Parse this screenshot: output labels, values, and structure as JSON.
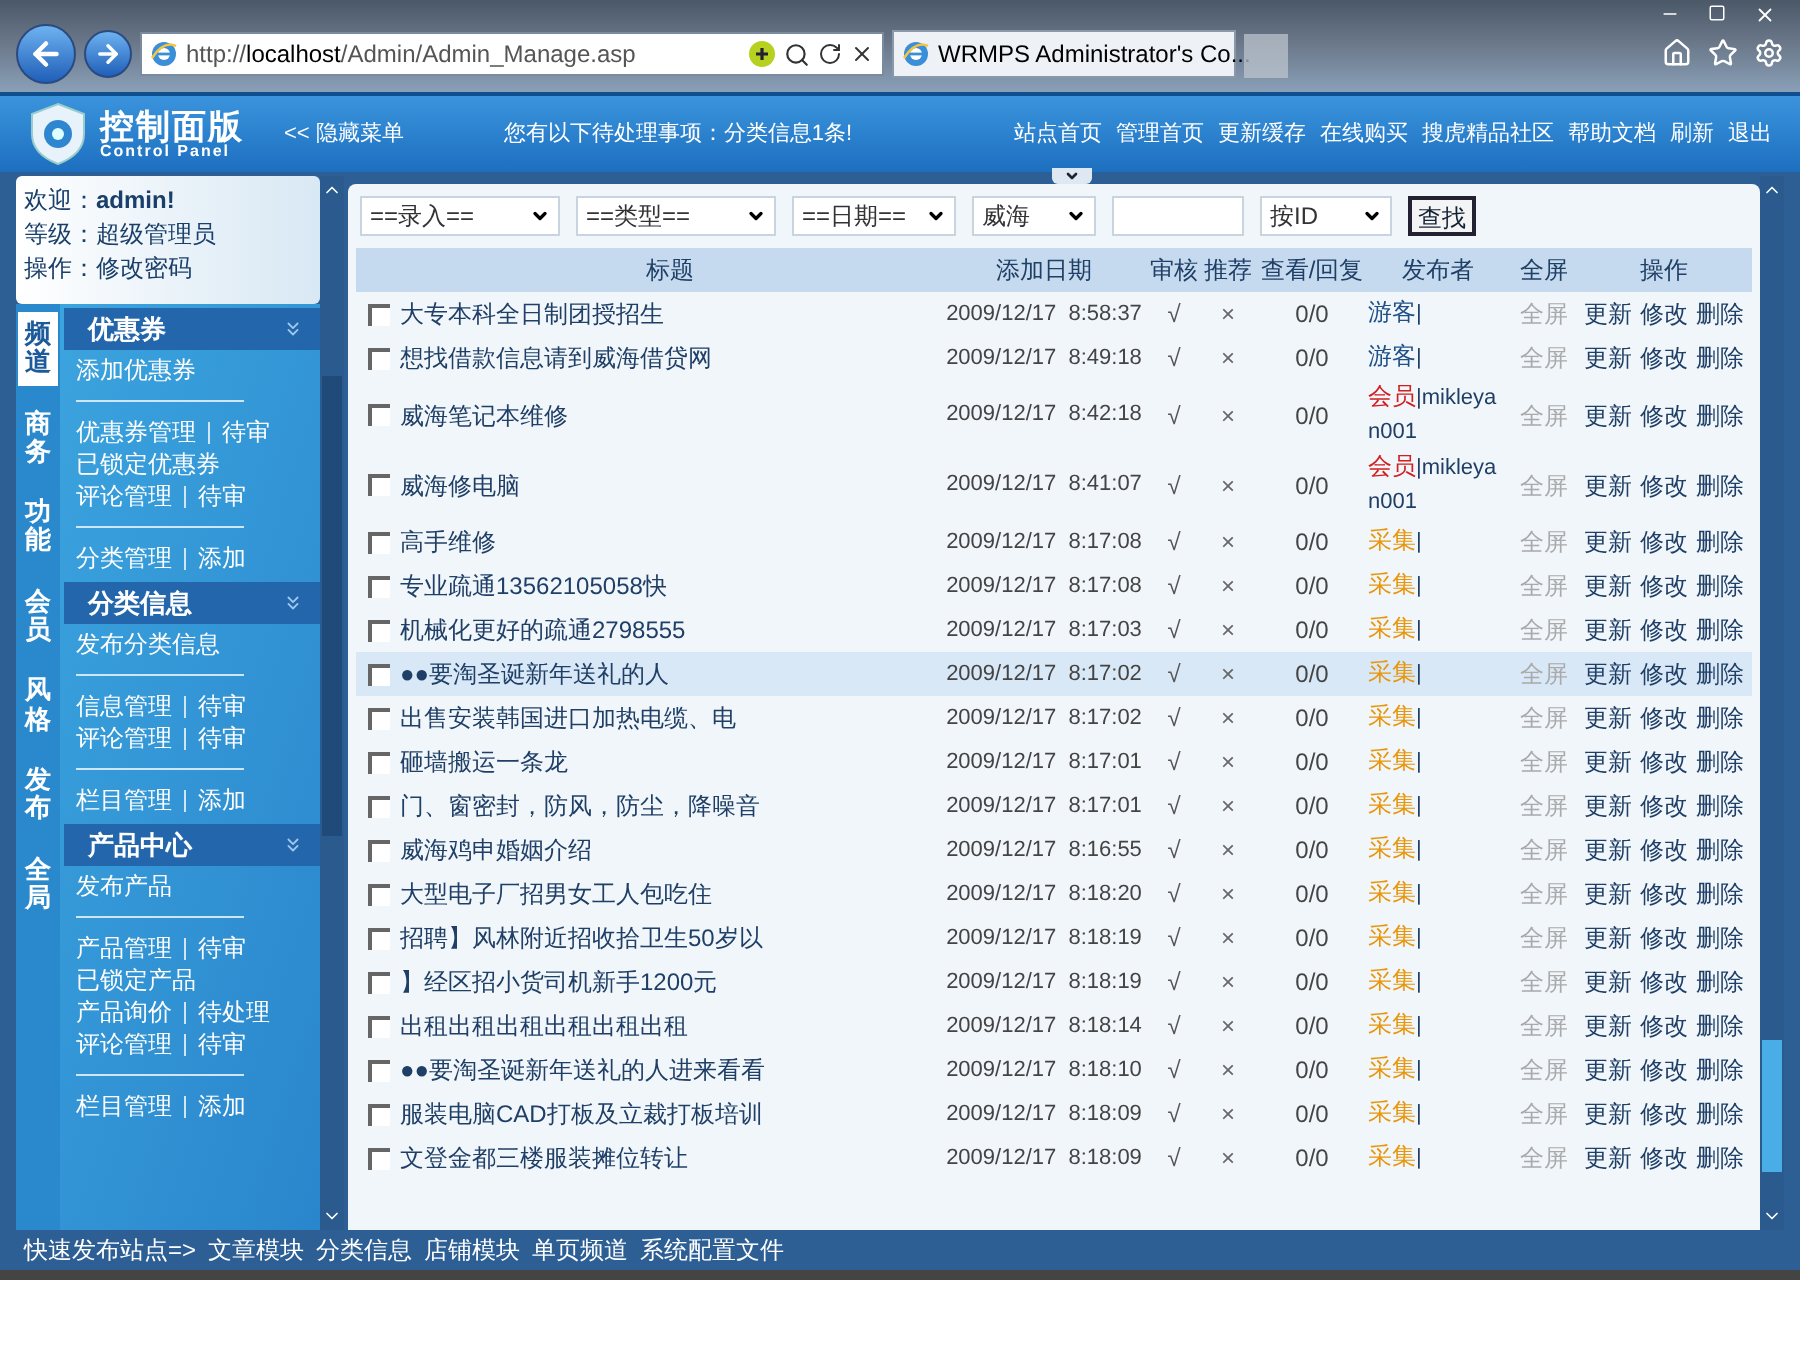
{
  "browser": {
    "address": {
      "prefix": "http://",
      "host": "localhost",
      "path": "/Admin/Admin_Manage.asp"
    },
    "tab": {
      "title": "WRMPS Administrator's Co..."
    }
  },
  "header": {
    "logo_title": "控制面版",
    "logo_subtitle": "Control Panel",
    "hide_menu_arrows": "<<",
    "hide_menu": "隐藏菜单",
    "notice": "您有以下待处理事项：分类信息1条!",
    "nav": [
      "站点首页",
      "管理首页",
      "更新缓存",
      "在线购买",
      "搜虎精品社区",
      "帮助文档",
      "刷新",
      "退出"
    ]
  },
  "user": {
    "lines": [
      "欢迎：**admin!**",
      "等级：超级管理员"
    ],
    "action_label": "操作：",
    "action_link": "修改密码"
  },
  "side_tabs": [
    {
      "label": "频道",
      "selected": true
    },
    {
      "label": "商务",
      "selected": false
    },
    {
      "label": "功能",
      "selected": false
    },
    {
      "label": "会员",
      "selected": false
    },
    {
      "label": "风格",
      "selected": false
    },
    {
      "label": "发布",
      "selected": false
    },
    {
      "label": "全局",
      "selected": false
    }
  ],
  "menu_sections": [
    {
      "title": "优惠券",
      "lines": [
        {
          "kind": "links",
          "links": [
            "添加优惠券"
          ]
        },
        {
          "kind": "divider"
        },
        {
          "kind": "links",
          "links": [
            "优惠券管理",
            "待审"
          ]
        },
        {
          "kind": "links",
          "links": [
            "已锁定优惠券"
          ]
        },
        {
          "kind": "links",
          "links": [
            "评论管理",
            "待审"
          ]
        },
        {
          "kind": "divider"
        },
        {
          "kind": "links",
          "links": [
            "分类管理",
            "添加"
          ]
        }
      ]
    },
    {
      "title": "分类信息",
      "lines": [
        {
          "kind": "links",
          "links": [
            "发布分类信息"
          ]
        },
        {
          "kind": "divider"
        },
        {
          "kind": "links",
          "links": [
            "信息管理",
            "待审"
          ]
        },
        {
          "kind": "links",
          "links": [
            "评论管理",
            "待审"
          ]
        },
        {
          "kind": "divider"
        },
        {
          "kind": "links",
          "links": [
            "栏目管理",
            "添加"
          ]
        }
      ]
    },
    {
      "title": "产品中心",
      "lines": [
        {
          "kind": "links",
          "links": [
            "发布产品"
          ]
        },
        {
          "kind": "divider"
        },
        {
          "kind": "links",
          "links": [
            "产品管理",
            "待审"
          ]
        },
        {
          "kind": "links",
          "links": [
            "已锁定产品"
          ]
        },
        {
          "kind": "links",
          "links": [
            "产品询价",
            "待处理"
          ]
        },
        {
          "kind": "links",
          "links": [
            "评论管理",
            "待审"
          ]
        },
        {
          "kind": "divider"
        },
        {
          "kind": "links",
          "links": [
            "栏目管理",
            "添加"
          ]
        }
      ]
    }
  ],
  "filters": {
    "selects": [
      "==录入==",
      "==类型==",
      "==日期==",
      "威海"
    ],
    "search_by": "按ID",
    "button": "查找"
  },
  "table": {
    "columns": [
      "标题",
      "添加日期",
      "审核",
      "推荐",
      "查看/回复",
      "发布者",
      "全屏",
      "操作"
    ],
    "rows": [
      {
        "title": "大专本科全日制团授招生",
        "date": "2009/12/17  8:58:37",
        "audit": "√",
        "recommend": "×",
        "views": "0/0",
        "publisher": {
          "kind": "guest",
          "label": "游客",
          "text": "|"
        },
        "fullscreen": "全屏",
        "actions": [
          "更新",
          "修改",
          "删除"
        ],
        "checked": false,
        "selected": false
      },
      {
        "title": "想找借款信息请到威海借贷网",
        "date": "2009/12/17  8:49:18",
        "audit": "√",
        "recommend": "×",
        "views": "0/0",
        "publisher": {
          "kind": "guest",
          "label": "游客",
          "text": "|"
        },
        "fullscreen": "全屏",
        "actions": [
          "更新",
          "修改",
          "删除"
        ],
        "checked": false,
        "selected": false
      },
      {
        "title": "威海笔记本维修",
        "date": "2009/12/17  8:42:18",
        "audit": "√",
        "recommend": "×",
        "views": "0/0",
        "publisher": {
          "kind": "member",
          "label": "会员",
          "text": "|mikleyan001"
        },
        "fullscreen": "全屏",
        "actions": [
          "更新",
          "修改",
          "删除"
        ],
        "checked": false,
        "selected": false
      },
      {
        "title": "威海修电脑",
        "date": "2009/12/17  8:41:07",
        "audit": "√",
        "recommend": "×",
        "views": "0/0",
        "publisher": {
          "kind": "member",
          "label": "会员",
          "text": "|mikleyan001"
        },
        "fullscreen": "全屏",
        "actions": [
          "更新",
          "修改",
          "删除"
        ],
        "checked": false,
        "selected": false
      },
      {
        "title": "高手维修",
        "date": "2009/12/17  8:17:08",
        "audit": "√",
        "recommend": "×",
        "views": "0/0",
        "publisher": {
          "kind": "collect",
          "label": "采集",
          "text": "|"
        },
        "fullscreen": "全屏",
        "actions": [
          "更新",
          "修改",
          "删除"
        ],
        "checked": false,
        "selected": false
      },
      {
        "title": "专业疏通13562105058快",
        "date": "2009/12/17  8:17:08",
        "audit": "√",
        "recommend": "×",
        "views": "0/0",
        "publisher": {
          "kind": "collect",
          "label": "采集",
          "text": "|"
        },
        "fullscreen": "全屏",
        "actions": [
          "更新",
          "修改",
          "删除"
        ],
        "checked": false,
        "selected": false
      },
      {
        "title": "机械化更好的疏通2798555",
        "date": "2009/12/17  8:17:03",
        "audit": "√",
        "recommend": "×",
        "views": "0/0",
        "publisher": {
          "kind": "collect",
          "label": "采集",
          "text": "|"
        },
        "fullscreen": "全屏",
        "actions": [
          "更新",
          "修改",
          "删除"
        ],
        "checked": false,
        "selected": false
      },
      {
        "title": "●●要淘圣诞新年送礼的人",
        "date": "2009/12/17  8:17:02",
        "audit": "√",
        "recommend": "×",
        "views": "0/0",
        "publisher": {
          "kind": "collect",
          "label": "采集",
          "text": "|"
        },
        "fullscreen": "全屏",
        "actions": [
          "更新",
          "修改",
          "删除"
        ],
        "checked": false,
        "selected": true
      },
      {
        "title": "出售安装韩国进口加热电缆、电",
        "date": "2009/12/17  8:17:02",
        "audit": "√",
        "recommend": "×",
        "views": "0/0",
        "publisher": {
          "kind": "collect",
          "label": "采集",
          "text": "|"
        },
        "fullscreen": "全屏",
        "actions": [
          "更新",
          "修改",
          "删除"
        ],
        "checked": false,
        "selected": false
      },
      {
        "title": "砸墙搬运一条龙",
        "date": "2009/12/17  8:17:01",
        "audit": "√",
        "recommend": "×",
        "views": "0/0",
        "publisher": {
          "kind": "collect",
          "label": "采集",
          "text": "|"
        },
        "fullscreen": "全屏",
        "actions": [
          "更新",
          "修改",
          "删除"
        ],
        "checked": false,
        "selected": false
      },
      {
        "title": "门、窗密封，防风，防尘，降噪音",
        "date": "2009/12/17  8:17:01",
        "audit": "√",
        "recommend": "×",
        "views": "0/0",
        "publisher": {
          "kind": "collect",
          "label": "采集",
          "text": "|"
        },
        "fullscreen": "全屏",
        "actions": [
          "更新",
          "修改",
          "删除"
        ],
        "checked": false,
        "selected": false
      },
      {
        "title": "威海鸡申婚姻介绍",
        "date": "2009/12/17  8:16:55",
        "audit": "√",
        "recommend": "×",
        "views": "0/0",
        "publisher": {
          "kind": "collect",
          "label": "采集",
          "text": "|"
        },
        "fullscreen": "全屏",
        "actions": [
          "更新",
          "修改",
          "删除"
        ],
        "checked": false,
        "selected": false
      },
      {
        "title": "大型电子厂招男女工人包吃住",
        "date": "2009/12/17  8:18:20",
        "audit": "√",
        "recommend": "×",
        "views": "0/0",
        "publisher": {
          "kind": "collect",
          "label": "采集",
          "text": "|"
        },
        "fullscreen": "全屏",
        "actions": [
          "更新",
          "修改",
          "删除"
        ],
        "checked": false,
        "selected": false
      },
      {
        "title": "招聘】风林附近招收拾卫生50岁以",
        "date": "2009/12/17  8:18:19",
        "audit": "√",
        "recommend": "×",
        "views": "0/0",
        "publisher": {
          "kind": "collect",
          "label": "采集",
          "text": "|"
        },
        "fullscreen": "全屏",
        "actions": [
          "更新",
          "修改",
          "删除"
        ],
        "checked": false,
        "selected": false
      },
      {
        "title": "】经区招小货司机新手1200元",
        "date": "2009/12/17  8:18:19",
        "audit": "√",
        "recommend": "×",
        "views": "0/0",
        "publisher": {
          "kind": "collect",
          "label": "采集",
          "text": "|"
        },
        "fullscreen": "全屏",
        "actions": [
          "更新",
          "修改",
          "删除"
        ],
        "checked": false,
        "selected": false
      },
      {
        "title": "出租出租出租出租出租出租",
        "date": "2009/12/17  8:18:14",
        "audit": "√",
        "recommend": "×",
        "views": "0/0",
        "publisher": {
          "kind": "collect",
          "label": "采集",
          "text": "|"
        },
        "fullscreen": "全屏",
        "actions": [
          "更新",
          "修改",
          "删除"
        ],
        "checked": false,
        "selected": false
      },
      {
        "title": "●●要淘圣诞新年送礼的人进来看看",
        "date": "2009/12/17  8:18:10",
        "audit": "√",
        "recommend": "×",
        "views": "0/0",
        "publisher": {
          "kind": "collect",
          "label": "采集",
          "text": "|"
        },
        "fullscreen": "全屏",
        "actions": [
          "更新",
          "修改",
          "删除"
        ],
        "checked": false,
        "selected": false
      },
      {
        "title": "服装电脑CAD打板及立裁打板培训",
        "date": "2009/12/17  8:18:09",
        "audit": "√",
        "recommend": "×",
        "views": "0/0",
        "publisher": {
          "kind": "collect",
          "label": "采集",
          "text": "|"
        },
        "fullscreen": "全屏",
        "actions": [
          "更新",
          "修改",
          "删除"
        ],
        "checked": false,
        "selected": false
      },
      {
        "title": "文登金都三楼服装摊位转让",
        "date": "2009/12/17  8:18:09",
        "audit": "√",
        "recommend": "×",
        "views": "0/0",
        "publisher": {
          "kind": "collect",
          "label": "采集",
          "text": "|"
        },
        "fullscreen": "全屏",
        "actions": [
          "更新",
          "修改",
          "删除"
        ],
        "checked": false,
        "selected": false
      }
    ]
  },
  "footer": {
    "label": "快速发布站点=>",
    "links": [
      "文章模块",
      "分类信息",
      "店铺模块",
      "单页频道",
      "系统配置文件"
    ]
  }
}
